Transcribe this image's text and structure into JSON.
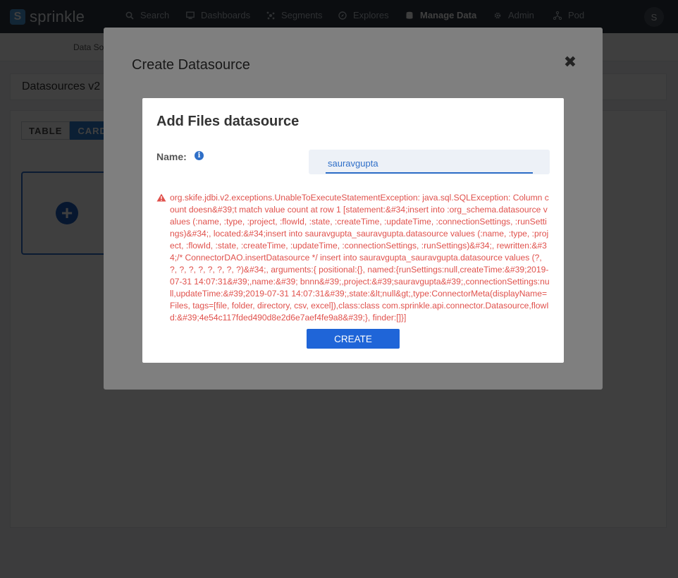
{
  "app": {
    "logo_letter": "S",
    "logo_text": "sprinkle"
  },
  "nav": {
    "items": [
      {
        "label": "Search",
        "icon": "search-icon"
      },
      {
        "label": "Dashboards",
        "icon": "monitor-icon"
      },
      {
        "label": "Segments",
        "icon": "segments-icon"
      },
      {
        "label": "Explores",
        "icon": "compass-icon"
      },
      {
        "label": "Manage Data",
        "icon": "database-icon",
        "active": true
      },
      {
        "label": "Admin",
        "icon": "gear-icon"
      },
      {
        "label": "Pod",
        "icon": "pod-icon"
      }
    ],
    "user_initial": "S"
  },
  "subnav": {
    "item": "Data So"
  },
  "page": {
    "title": "Datasources v2",
    "view_toggle": [
      "TABLE",
      "CARD"
    ]
  },
  "outer_modal": {
    "title": "Create Datasource",
    "close_symbol": "✖"
  },
  "inner_modal": {
    "title": "Add Files datasource",
    "name_label": "Name:",
    "name_value": "sauravgupta",
    "error_text": "org.skife.jdbi.v2.exceptions.UnableToExecuteStatementException: java.sql.SQLException: Column count doesn&#39;t match value count at row 1 [statement:&#34;insert into :org_schema.datasource values (:name, :type, :project, :flowId, :state, :createTime, :updateTime, :connectionSettings, :runSettings)&#34;, located:&#34;insert into sauravgupta_sauravgupta.datasource values (:name, :type, :project, :flowId, :state, :createTime, :updateTime, :connectionSettings, :runSettings)&#34;, rewritten:&#34;/* ConnectorDAO.insertDatasource */ insert into sauravgupta_sauravgupta.datasource values (?, ?, ?, ?, ?, ?, ?, ?, ?)&#34;, arguments:{ positional:{}, named:{runSettings:null,createTime:&#39;2019-07-31 14:07:31&#39;,name:&#39; bnnn&#39;,project:&#39;sauravgupta&#39;,connectionSettings:null,updateTime:&#39;2019-07-31 14:07:31&#39;,state:&lt;null&gt;,type:ConnectorMeta(displayName=Files, tags=[file, folder, directory, csv, excel]),class:class com.sprinkle.api.connector.Datasource,flowId:&#39;4e54c117fded490d8e2d6e7aef4fe9a8&#39;}, finder:[]}]",
    "create_label": "CREATE"
  },
  "colors": {
    "accent": "#1f65d8",
    "error": "#e0514c",
    "nav_bg": "#2c3440"
  }
}
